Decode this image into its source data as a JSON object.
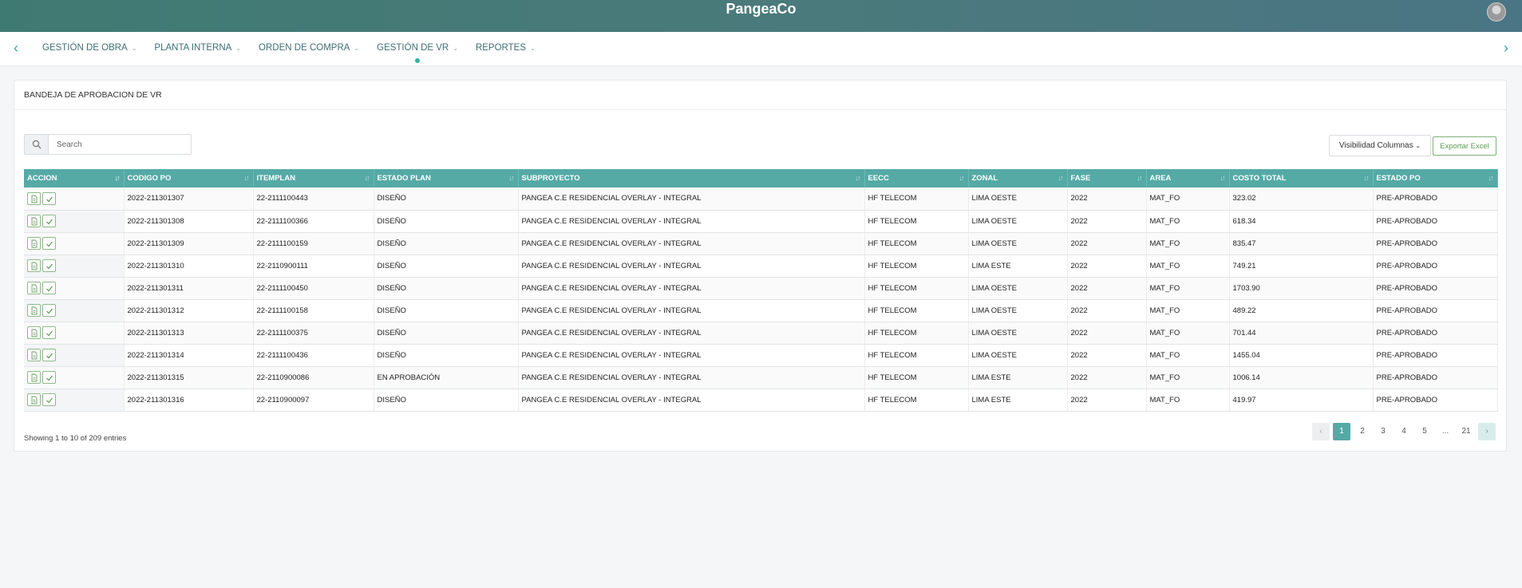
{
  "app": {
    "title": "PangeaCo"
  },
  "menu": [
    {
      "label": "GESTIÓN DE OBRA"
    },
    {
      "label": "PLANTA INTERNA"
    },
    {
      "label": "ORDEN DE COMPRA"
    },
    {
      "label": "GESTIÓN DE VR",
      "active": true
    },
    {
      "label": "REPORTES"
    }
  ],
  "page": {
    "title": "BANDEJA DE APROBACION DE VR",
    "search_placeholder": "Search",
    "visibility_label": "Visibilidad Columnas",
    "export_label": "Exportar Excel",
    "entries_text": "Showing 1 to 10 of 209 entries"
  },
  "table": {
    "columns": [
      "ACCION",
      "CODIGO PO",
      "ITEMPLAN",
      "ESTADO PLAN",
      "SUBPROYECTO",
      "EECC",
      "ZONAL",
      "FASE",
      "AREA",
      "COSTO TOTAL",
      "ESTADO PO"
    ],
    "rows": [
      [
        "2022-211301307",
        "22-2111100443",
        "DISEÑO",
        "PANGEA C.E RESIDENCIAL OVERLAY - INTEGRAL",
        "HF TELECOM",
        "LIMA OESTE",
        "2022",
        "MAT_FO",
        "323.02",
        "PRE-APROBADO"
      ],
      [
        "2022-211301308",
        "22-2111100366",
        "DISEÑO",
        "PANGEA C.E RESIDENCIAL OVERLAY - INTEGRAL",
        "HF TELECOM",
        "LIMA OESTE",
        "2022",
        "MAT_FO",
        "618.34",
        "PRE-APROBADO"
      ],
      [
        "2022-211301309",
        "22-2111100159",
        "DISEÑO",
        "PANGEA C.E RESIDENCIAL OVERLAY - INTEGRAL",
        "HF TELECOM",
        "LIMA OESTE",
        "2022",
        "MAT_FO",
        "835.47",
        "PRE-APROBADO"
      ],
      [
        "2022-211301310",
        "22-2110900111",
        "DISEÑO",
        "PANGEA C.E RESIDENCIAL OVERLAY - INTEGRAL",
        "HF TELECOM",
        "LIMA ESTE",
        "2022",
        "MAT_FO",
        "749.21",
        "PRE-APROBADO"
      ],
      [
        "2022-211301311",
        "22-2111100450",
        "DISEÑO",
        "PANGEA C.E RESIDENCIAL OVERLAY - INTEGRAL",
        "HF TELECOM",
        "LIMA OESTE",
        "2022",
        "MAT_FO",
        "1703.90",
        "PRE-APROBADO"
      ],
      [
        "2022-211301312",
        "22-2111100158",
        "DISEÑO",
        "PANGEA C.E RESIDENCIAL OVERLAY - INTEGRAL",
        "HF TELECOM",
        "LIMA OESTE",
        "2022",
        "MAT_FO",
        "489.22",
        "PRE-APROBADO"
      ],
      [
        "2022-211301313",
        "22-2111100375",
        "DISEÑO",
        "PANGEA C.E RESIDENCIAL OVERLAY - INTEGRAL",
        "HF TELECOM",
        "LIMA OESTE",
        "2022",
        "MAT_FO",
        "701.44",
        "PRE-APROBADO"
      ],
      [
        "2022-211301314",
        "22-2111100436",
        "DISEÑO",
        "PANGEA C.E RESIDENCIAL OVERLAY - INTEGRAL",
        "HF TELECOM",
        "LIMA OESTE",
        "2022",
        "MAT_FO",
        "1455.04",
        "PRE-APROBADO"
      ],
      [
        "2022-211301315",
        "22-2110900086",
        "EN APROBACIÓN",
        "PANGEA C.E RESIDENCIAL OVERLAY - INTEGRAL",
        "HF TELECOM",
        "LIMA ESTE",
        "2022",
        "MAT_FO",
        "1006.14",
        "PRE-APROBADO"
      ],
      [
        "2022-211301316",
        "22-2110900097",
        "DISEÑO",
        "PANGEA C.E RESIDENCIAL OVERLAY - INTEGRAL",
        "HF TELECOM",
        "LIMA ESTE",
        "2022",
        "MAT_FO",
        "419.97",
        "PRE-APROBADO"
      ]
    ]
  },
  "pagination": {
    "current": "1",
    "pages": [
      "2",
      "3",
      "4",
      "5",
      "...",
      "21"
    ]
  },
  "colors": {
    "header": "#4a7a7b",
    "accent": "#55aaa6",
    "export_green": "#5b9b55"
  },
  "icons": {
    "prev": "chevron-left-icon",
    "next": "chevron-right-icon",
    "search": "search-icon",
    "doc": "document-icon",
    "check": "check-icon"
  }
}
